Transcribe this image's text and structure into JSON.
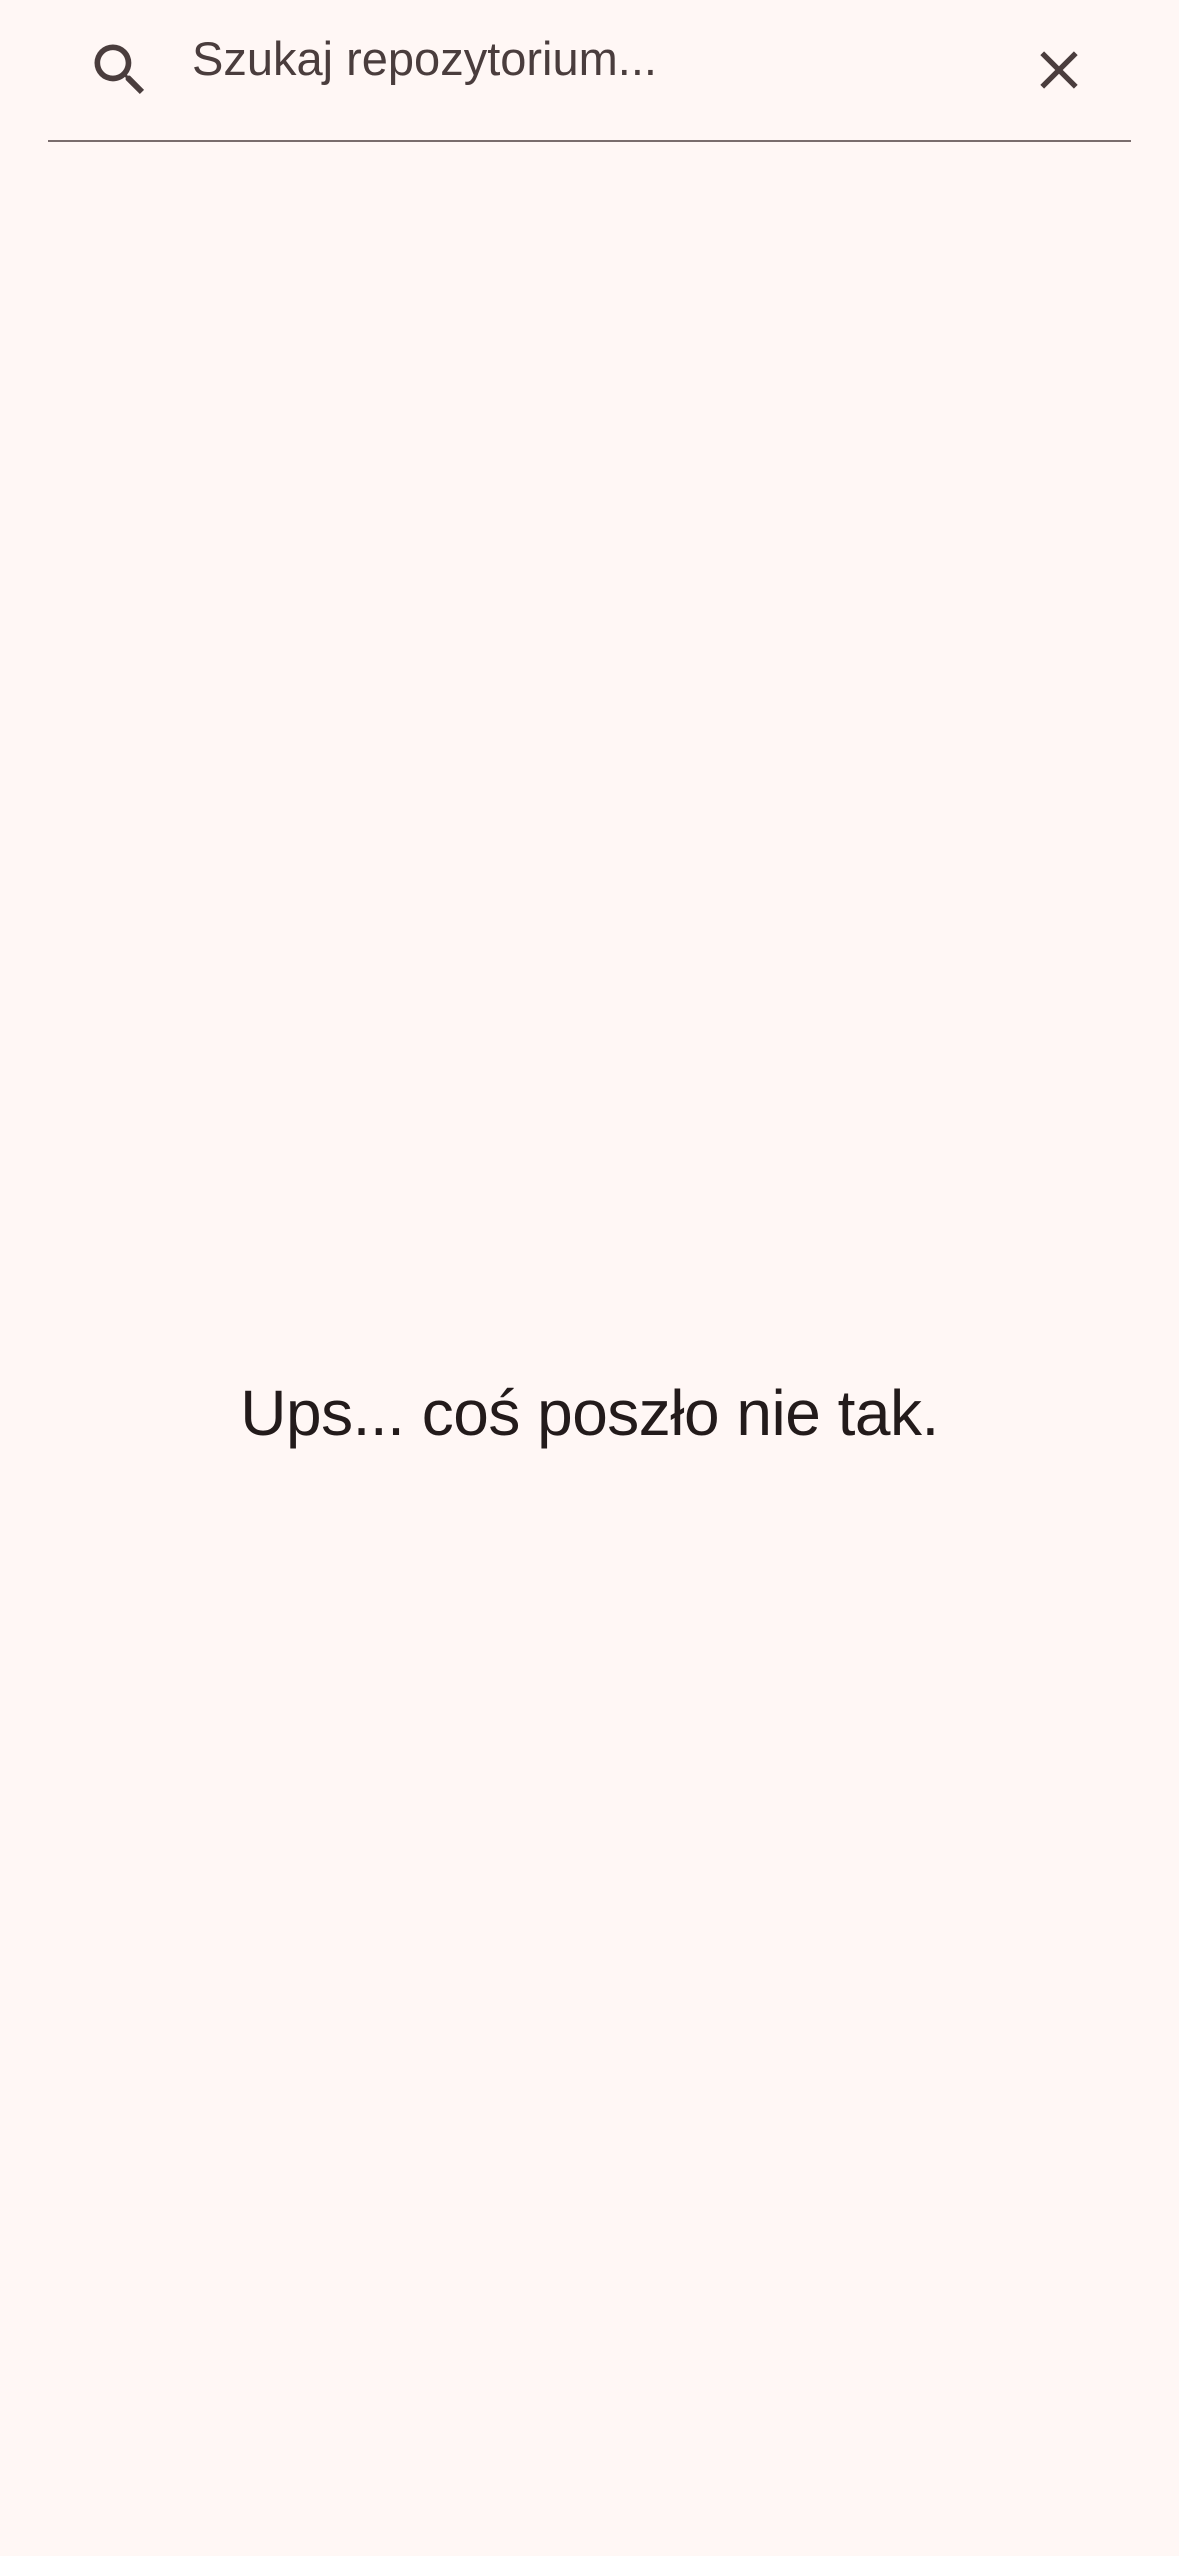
{
  "search": {
    "placeholder": "Szukaj repozytorium...",
    "value": "",
    "search_icon": "search-icon",
    "clear_icon": "close-icon"
  },
  "content": {
    "error_message": "Ups... coś poszło nie tak."
  },
  "colors": {
    "background": "#fff7f5",
    "text_primary": "#231b1b",
    "text_secondary": "#4a3d3d",
    "divider": "#7a6d6d"
  }
}
